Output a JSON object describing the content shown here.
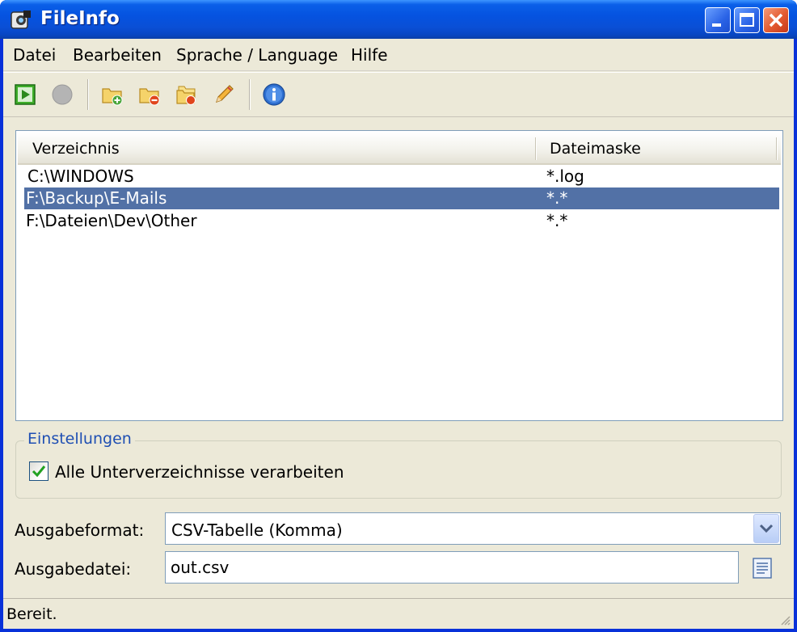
{
  "window": {
    "title": "FileInfo"
  },
  "menu": [
    "Datei",
    "Bearbeiten",
    "Sprache / Language",
    "Hilfe"
  ],
  "toolbar": {
    "icons": [
      "play-icon",
      "stop-icon",
      "folder-add-icon",
      "folder-remove-icon",
      "folder-edit-icon",
      "pencil-icon",
      "info-icon"
    ]
  },
  "list": {
    "columns": [
      "Verzeichnis",
      "Dateimaske"
    ],
    "rows": [
      {
        "dir": "C:\\WINDOWS",
        "mask": "*.log",
        "selected": false
      },
      {
        "dir": "F:\\Backup\\E-Mails",
        "mask": "*.*",
        "selected": true
      },
      {
        "dir": "F:\\Dateien\\Dev\\Other",
        "mask": "*.*",
        "selected": false
      }
    ]
  },
  "settings": {
    "group_title": "Einstellungen",
    "subdirs_label": "Alle Unterverzeichnisse verarbeiten",
    "subdirs_checked": true
  },
  "output": {
    "format_label": "Ausgabeformat:",
    "format_value": "CSV-Tabelle (Komma)",
    "file_label": "Ausgabedatei:",
    "file_value": "out.csv"
  },
  "status": {
    "text": "Bereit."
  },
  "colors": {
    "selection": "#5271a6",
    "title_bar": "#0553e0",
    "group_title": "#1f4fb3"
  }
}
